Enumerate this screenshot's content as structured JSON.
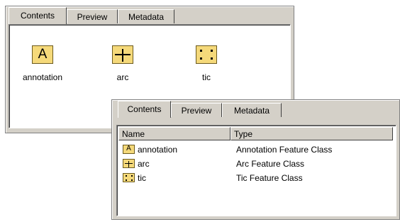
{
  "back_window": {
    "tabs": [
      "Contents",
      "Preview",
      "Metadata"
    ],
    "items": [
      {
        "label": "annotation",
        "icon": "annotation-icon"
      },
      {
        "label": "arc",
        "icon": "arc-icon"
      },
      {
        "label": "tic",
        "icon": "tic-icon"
      }
    ]
  },
  "front_window": {
    "tabs": [
      "Contents",
      "Preview",
      "Metadata"
    ],
    "columns": [
      "Name",
      "Type"
    ],
    "rows": [
      {
        "name": "annotation",
        "type": "Annotation Feature Class",
        "icon": "annotation-icon"
      },
      {
        "name": "arc",
        "type": "Arc Feature Class",
        "icon": "arc-icon"
      },
      {
        "name": "tic",
        "type": "Tic Feature Class",
        "icon": "tic-icon"
      }
    ]
  },
  "icons": {
    "annotation_glyph": "A"
  },
  "colors": {
    "icon_fill": "#f5d97a",
    "chrome": "#d4d0c8"
  }
}
